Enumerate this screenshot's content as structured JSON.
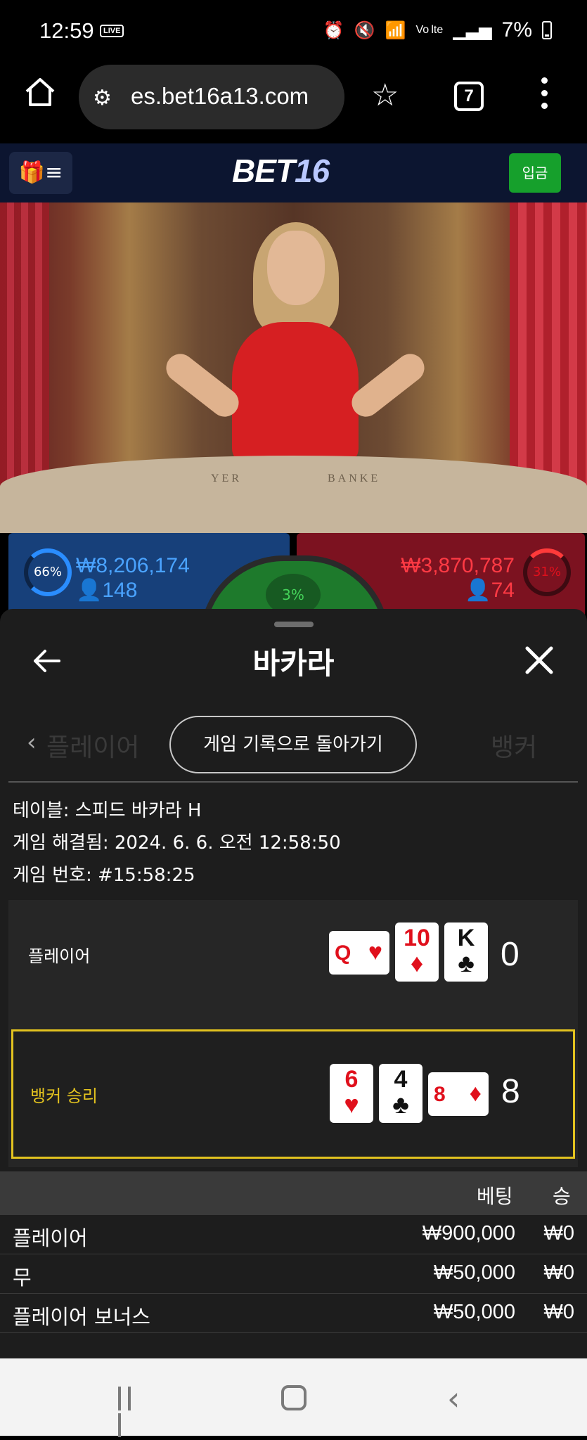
{
  "status_bar": {
    "time": "12:59",
    "live": "LIVE",
    "network": "Vo lte",
    "battery": "7%"
  },
  "browser": {
    "url": "es.bet16a13.com",
    "tab_count": "7"
  },
  "site": {
    "logo_main": "BET",
    "logo_num": "16",
    "deposit_label": "입금"
  },
  "video": {
    "table_player": "YER",
    "table_banker": "BANKE"
  },
  "bet_stats": {
    "player": {
      "percent": "66%",
      "amount": "₩8,206,174",
      "count": "148"
    },
    "banker": {
      "percent": "31%",
      "amount": "₩3,870,787",
      "count": "74"
    },
    "tie": {
      "percent": "3%"
    }
  },
  "modal": {
    "title": "바카라",
    "back_history_label": "게임 기록으로 돌아가기",
    "ghost_left": "플레이어",
    "ghost_right": "뱅커",
    "info": {
      "table": "테이블: 스피드 바카라 H",
      "resolved": "게임 해결됨: 2024. 6. 6. 오전 12:58:50",
      "game_no": "게임 번호: #15:58:25"
    },
    "player_row": {
      "label": "플레이어",
      "cards": [
        {
          "rank": "Q",
          "suit": "♥",
          "color": "red",
          "orientation": "horizontal"
        },
        {
          "rank": "10",
          "suit": "♦",
          "color": "red",
          "orientation": "vertical"
        },
        {
          "rank": "K",
          "suit": "♣",
          "color": "black",
          "orientation": "vertical"
        }
      ],
      "score": "0"
    },
    "banker_row": {
      "label": "뱅커 승리",
      "cards": [
        {
          "rank": "6",
          "suit": "♥",
          "color": "red",
          "orientation": "vertical"
        },
        {
          "rank": "4",
          "suit": "♣",
          "color": "black",
          "orientation": "vertical"
        },
        {
          "rank": "8",
          "suit": "♦",
          "color": "red",
          "orientation": "horizontal"
        }
      ],
      "score": "8"
    },
    "bets_table": {
      "headers": {
        "bet": "베팅",
        "win": "승"
      },
      "rows": [
        {
          "name": "플레이어",
          "bet": "₩900,000",
          "win": "₩0"
        },
        {
          "name": "무",
          "bet": "₩50,000",
          "win": "₩0"
        },
        {
          "name": "플레이어 보너스",
          "bet": "₩50,000",
          "win": "₩0"
        }
      ]
    }
  },
  "colors": {
    "accent_gold": "#e2c21f",
    "deposit_green": "#16a02c",
    "player_blue": "#4aa3ff",
    "banker_red": "#ff3a44"
  }
}
